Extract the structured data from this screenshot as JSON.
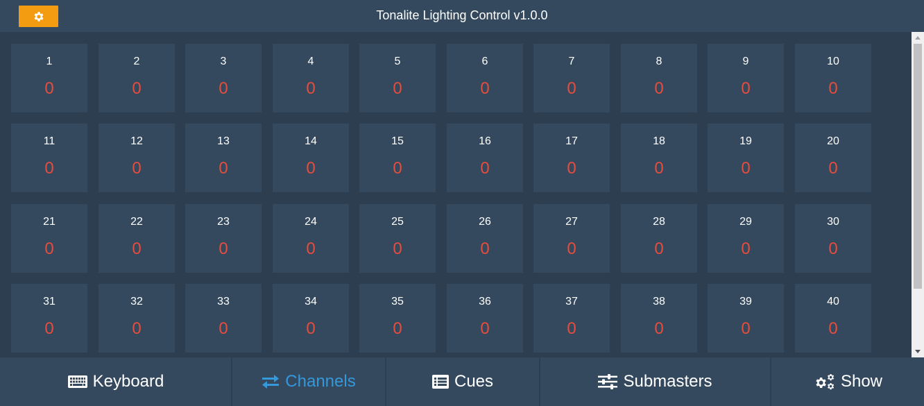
{
  "header": {
    "title": "Tonalite Lighting Control v1.0.0",
    "settings_icon": "gear-icon",
    "accent_color": "#f39c12"
  },
  "channels": [
    {
      "number": "1",
      "value": "0"
    },
    {
      "number": "2",
      "value": "0"
    },
    {
      "number": "3",
      "value": "0"
    },
    {
      "number": "4",
      "value": "0"
    },
    {
      "number": "5",
      "value": "0"
    },
    {
      "number": "6",
      "value": "0"
    },
    {
      "number": "7",
      "value": "0"
    },
    {
      "number": "8",
      "value": "0"
    },
    {
      "number": "9",
      "value": "0"
    },
    {
      "number": "10",
      "value": "0"
    },
    {
      "number": "11",
      "value": "0"
    },
    {
      "number": "12",
      "value": "0"
    },
    {
      "number": "13",
      "value": "0"
    },
    {
      "number": "14",
      "value": "0"
    },
    {
      "number": "15",
      "value": "0"
    },
    {
      "number": "16",
      "value": "0"
    },
    {
      "number": "17",
      "value": "0"
    },
    {
      "number": "18",
      "value": "0"
    },
    {
      "number": "19",
      "value": "0"
    },
    {
      "number": "20",
      "value": "0"
    },
    {
      "number": "21",
      "value": "0"
    },
    {
      "number": "22",
      "value": "0"
    },
    {
      "number": "23",
      "value": "0"
    },
    {
      "number": "24",
      "value": "0"
    },
    {
      "number": "25",
      "value": "0"
    },
    {
      "number": "26",
      "value": "0"
    },
    {
      "number": "27",
      "value": "0"
    },
    {
      "number": "28",
      "value": "0"
    },
    {
      "number": "29",
      "value": "0"
    },
    {
      "number": "30",
      "value": "0"
    },
    {
      "number": "31",
      "value": "0"
    },
    {
      "number": "32",
      "value": "0"
    },
    {
      "number": "33",
      "value": "0"
    },
    {
      "number": "34",
      "value": "0"
    },
    {
      "number": "35",
      "value": "0"
    },
    {
      "number": "36",
      "value": "0"
    },
    {
      "number": "37",
      "value": "0"
    },
    {
      "number": "38",
      "value": "0"
    },
    {
      "number": "39",
      "value": "0"
    },
    {
      "number": "40",
      "value": "0"
    }
  ],
  "nav": {
    "items": [
      {
        "label": "Keyboard",
        "icon": "keyboard-icon",
        "active": false
      },
      {
        "label": "Channels",
        "icon": "exchange-icon",
        "active": true
      },
      {
        "label": "Cues",
        "icon": "list-icon",
        "active": false
      },
      {
        "label": "Submasters",
        "icon": "sliders-icon",
        "active": false
      },
      {
        "label": "Show",
        "icon": "gears-icon",
        "active": false
      }
    ]
  },
  "colors": {
    "background": "#2c3e50",
    "panel": "#34495e",
    "value_text": "#e74c3c",
    "active_nav": "#3498db"
  }
}
